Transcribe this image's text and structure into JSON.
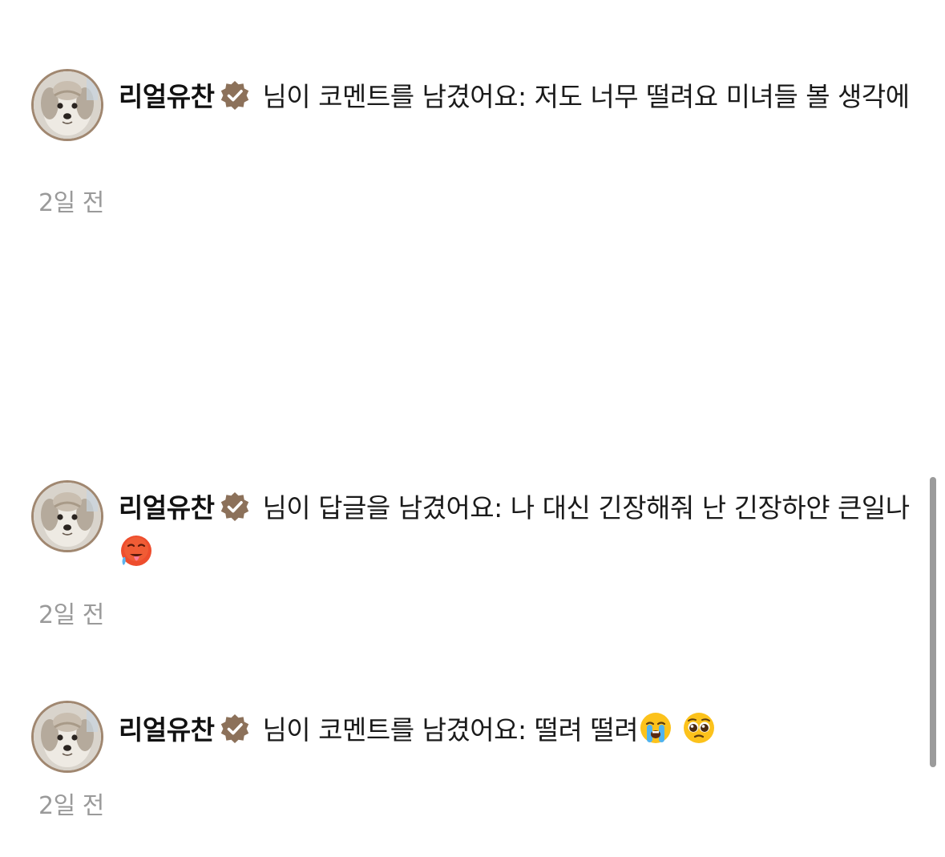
{
  "notifications": [
    {
      "username": "리얼유찬",
      "action": " 님이 코멘트를 남겼어요: ",
      "body": "저도 너무 떨려요 미녀들 볼 생각에",
      "time": "2일 전",
      "emojis": []
    },
    {
      "username": "리얼유찬",
      "action": " 님이 답글을 남겼어요: ",
      "body": "나 대신 긴장해줘 난 긴장하얀 큰일나",
      "time": "2일 전",
      "emojis": [
        "hot-face-emoji"
      ]
    },
    {
      "username": "리얼유찬",
      "action": " 님이 코멘트를 남겼어요: ",
      "body": "떨려 떨려",
      "time": "2일 전",
      "emojis": [
        "loudly-crying-face-emoji",
        "pleading-face-emoji"
      ]
    }
  ],
  "icons": {
    "badge": "verified-badge-icon",
    "avatar": "dog-avatar"
  },
  "colors": {
    "badge": "#8c715a",
    "avatar_border": "#a08770",
    "timestamp": "#9a9a9a",
    "text": "#1a1a1a"
  }
}
